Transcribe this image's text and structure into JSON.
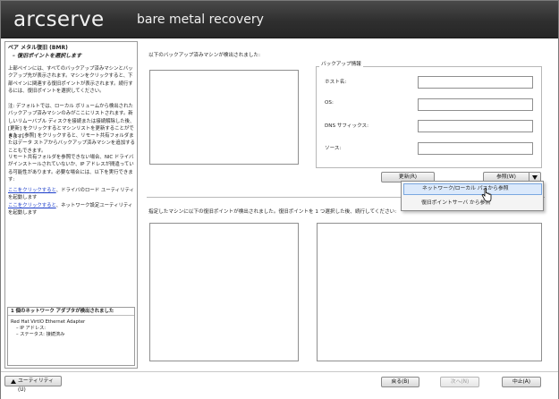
{
  "app": {
    "brand": "arcserve",
    "title": "bare metal recovery"
  },
  "left_panel": {
    "title": "ベア メタル復旧 (BMR)",
    "subtitle": "– 復旧ポイントを選択します",
    "para1": "上部ペインには、すべてのバックアップ済みマシンとバックアップ先が表示されます。マシンをクリックすると、下部ペインに関連する復旧ポイントが表示されます。続行するには、復旧ポイントを選択してください。",
    "para2": "注: デフォルトでは、ローカル ボリュームから検出されたバックアップ済みマシンのみがここにリストされます。新しいリムーバブル ディスクを接続または接続解除した後、[更新] をクリックするとマシンリストを更新することができます。",
    "para3": "また、[参照] をクリックすると、リモート共有フォルダまたはデータ ストアからバックアップ済みマシンを追加することもできます。",
    "para4": "リモート共有フォルダを参照できない場合、NIC ドライバがインストールされていないか、IP アドレスが間違っている可能性があります。必要な場合には、以下を実行できます:",
    "link1": "ここをクリックすると",
    "link1_rest": "、ドライバのロード ユーティリティを起動します",
    "link2": "ここをクリックすると",
    "link2_rest": "、ネットワーク設定ユーティリティを起動します",
    "nic": {
      "header": "1 個のネットワーク アダプタが検出されました",
      "adapter": "Red Hat VirtIO Ethernet Adapter",
      "ip_label": "– IP アドレス:",
      "status_label": "– ステータス: 接続済み"
    }
  },
  "main": {
    "machines_label": "以下のバックアップ済みマシンが検出されました:",
    "backup_info": {
      "legend": "バックアップ情報",
      "fields": [
        {
          "label": "ホスト名:",
          "value": ""
        },
        {
          "label": "OS:",
          "value": ""
        },
        {
          "label": "DNS サフィックス:",
          "value": ""
        },
        {
          "label": "ソース:",
          "value": ""
        }
      ]
    },
    "refresh_label": "更新(R)",
    "browse_label": "参照(W)",
    "points_label": "指定したマシンに以下の復旧ポイントが検出されました。復旧ポイントを 1 つ選択した後、続行してください:",
    "menu": {
      "items": [
        "ネットワーク/ローカル パスから参照",
        "復旧ポイントサーバ から参照"
      ]
    }
  },
  "footer": {
    "utility_label": "ユーティリティ(U)",
    "back_label": "戻る(B)",
    "next_label": "次へ(N)",
    "abort_label": "中止(A)"
  }
}
